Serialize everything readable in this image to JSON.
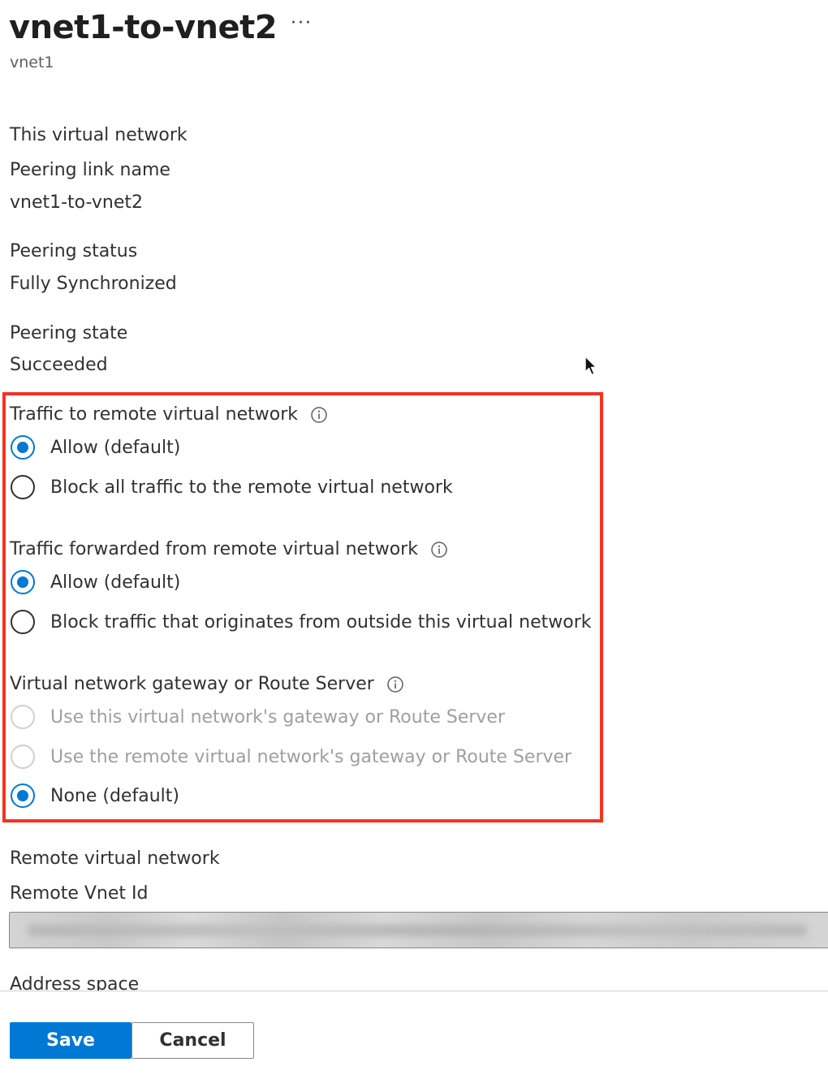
{
  "header": {
    "title": "vnet1-to-vnet2",
    "more_label": "···",
    "subtitle": "vnet1"
  },
  "local": {
    "section_title": "This virtual network",
    "peering_link_name_label": "Peering link name",
    "peering_link_name_value": "vnet1-to-vnet2",
    "peering_status_label": "Peering status",
    "peering_status_value": "Fully Synchronized",
    "peering_state_label": "Peering state",
    "peering_state_value": "Succeeded"
  },
  "traffic_to_remote": {
    "label": "Traffic to remote virtual network",
    "options": [
      {
        "label": "Allow (default)",
        "checked": true,
        "disabled": false
      },
      {
        "label": "Block all traffic to the remote virtual network",
        "checked": false,
        "disabled": false
      }
    ]
  },
  "traffic_forwarded": {
    "label": "Traffic forwarded from remote virtual network",
    "options": [
      {
        "label": "Allow (default)",
        "checked": true,
        "disabled": false
      },
      {
        "label": "Block traffic that originates from outside this virtual network",
        "checked": false,
        "disabled": false
      }
    ]
  },
  "gateway": {
    "label": "Virtual network gateway or Route Server",
    "options": [
      {
        "label": "Use this virtual network's gateway or Route Server",
        "checked": false,
        "disabled": true
      },
      {
        "label": "Use the remote virtual network's gateway or Route Server",
        "checked": false,
        "disabled": true
      },
      {
        "label": "None (default)",
        "checked": true,
        "disabled": false
      }
    ]
  },
  "remote": {
    "section_title": "Remote virtual network",
    "vnet_id_label": "Remote Vnet Id",
    "address_space_label": "Address space"
  },
  "footer": {
    "save_label": "Save",
    "cancel_label": "Cancel"
  },
  "colors": {
    "accent": "#0078d4",
    "highlight": "#f53123"
  }
}
